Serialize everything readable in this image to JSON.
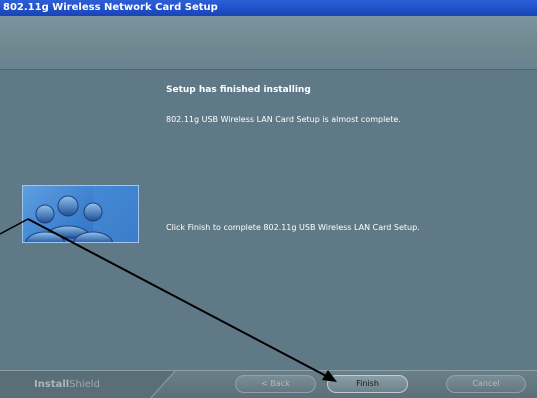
{
  "window": {
    "title": "802.11g Wireless Network Card Setup"
  },
  "content": {
    "heading": "Setup has finished installing",
    "message_almost_complete": "802.11g USB Wireless LAN Card Setup is almost complete.",
    "message_click_finish": "Click Finish to complete 802.11g USB Wireless LAN Card Setup."
  },
  "footer": {
    "brand_install": "Install",
    "brand_shield": "Shield",
    "back_label": "< Back",
    "finish_label": "Finish",
    "cancel_label": "Cancel"
  },
  "icons": {
    "users": "users-icon",
    "pointer_arrow": "arrow-annotation"
  },
  "colors": {
    "title_bar": "#1f4fc8",
    "background": "#5f7a86",
    "banner": "#71888f",
    "tile": "#3c7fcf",
    "text": "#ffffff"
  }
}
